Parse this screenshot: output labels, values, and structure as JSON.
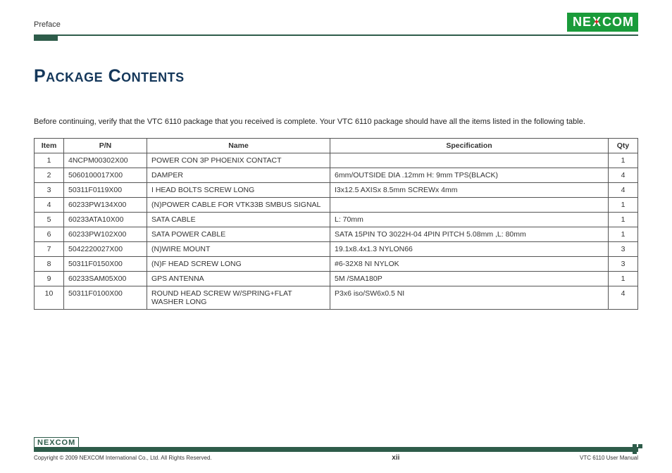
{
  "header": {
    "section": "Preface"
  },
  "logo_text": "NEXCOM",
  "title": "Package Contents",
  "intro": "Before continuing, verify that the VTC 6110 package that you received is complete. Your VTC 6110 package should have all the items listed in the following table.",
  "table": {
    "headers": {
      "item": "Item",
      "pn": "P/N",
      "name": "Name",
      "spec": "Specification",
      "qty": "Qty"
    },
    "rows": [
      {
        "item": "1",
        "pn": "4NCPM00302X00",
        "name": "POWER CON 3P PHOENIX CONTACT",
        "spec": "",
        "qty": "1"
      },
      {
        "item": "2",
        "pn": "5060100017X00",
        "name": "DAMPER",
        "spec": "6mm/OUTSIDE DIA .12mm H: 9mm TPS(BLACK)",
        "qty": "4"
      },
      {
        "item": "3",
        "pn": "50311F0119X00",
        "name": "I HEAD BOLTS SCREW LONG",
        "spec": "I3x12.5 AXISx 8.5mm SCREWx 4mm",
        "qty": "4"
      },
      {
        "item": "4",
        "pn": "60233PW134X00",
        "name": "(N)POWER CABLE FOR VTK33B SMBUS SIGNAL",
        "spec": "",
        "qty": "1"
      },
      {
        "item": "5",
        "pn": "60233ATA10X00",
        "name": "SATA CABLE",
        "spec": "L: 70mm",
        "qty": "1"
      },
      {
        "item": "6",
        "pn": "60233PW102X00",
        "name": "SATA POWER CABLE",
        "spec": "SATA 15PIN TO 3022H-04 4PIN PITCH 5.08mm ,L: 80mm",
        "qty": "1"
      },
      {
        "item": "7",
        "pn": "5042220027X00",
        "name": "(N)WIRE MOUNT",
        "spec": "19.1x8.4x1.3 NYLON66",
        "qty": "3"
      },
      {
        "item": "8",
        "pn": "50311F0150X00",
        "name": "(N)F HEAD SCREW LONG",
        "spec": "#6-32X8 NI NYLOK",
        "qty": "3"
      },
      {
        "item": "9",
        "pn": "60233SAM05X00",
        "name": "GPS ANTENNA",
        "spec": "5M /SMA180P",
        "qty": "1"
      },
      {
        "item": "10",
        "pn": "50311F0100X00",
        "name": "ROUND HEAD SCREW W/SPRING+FLAT WASHER LONG",
        "spec": "P3x6 iso/SW6x0.5 NI",
        "qty": "4"
      }
    ]
  },
  "footer": {
    "copyright": "Copyright © 2009 NEXCOM International Co., Ltd. All Rights Reserved.",
    "page": "xii",
    "doc": "VTC 6110 User Manual"
  }
}
